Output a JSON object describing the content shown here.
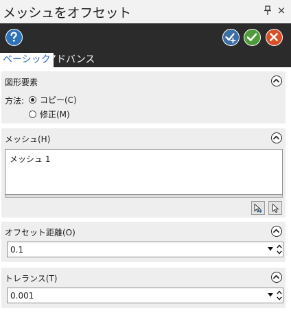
{
  "window": {
    "title": "メッシュをオフセット",
    "close_glyph": "×"
  },
  "toolbar": {
    "help": "help-icon",
    "apply": "apply-icon",
    "ok": "ok-icon",
    "cancel": "cancel-icon",
    "colors": {
      "help": "#2f72b8",
      "apply": "#3d6ea3",
      "ok": "#4f9a3a",
      "cancel": "#d6512a"
    }
  },
  "tabs": [
    {
      "label": "ベーシック",
      "active": true
    },
    {
      "label": "アドバンス",
      "active": false
    }
  ],
  "geometry": {
    "title": "図形要素",
    "method_label": "方法:",
    "options": [
      {
        "label": "コピー(C)",
        "checked": true
      },
      {
        "label": "修正(M)",
        "checked": false
      }
    ]
  },
  "mesh": {
    "title": "メッシュ(H)",
    "items": [
      "メッシュ 1"
    ]
  },
  "offset": {
    "title": "オフセット距離(O)",
    "value": "0.1"
  },
  "tolerance": {
    "title": "トレランス(T)",
    "value": "0.001"
  }
}
